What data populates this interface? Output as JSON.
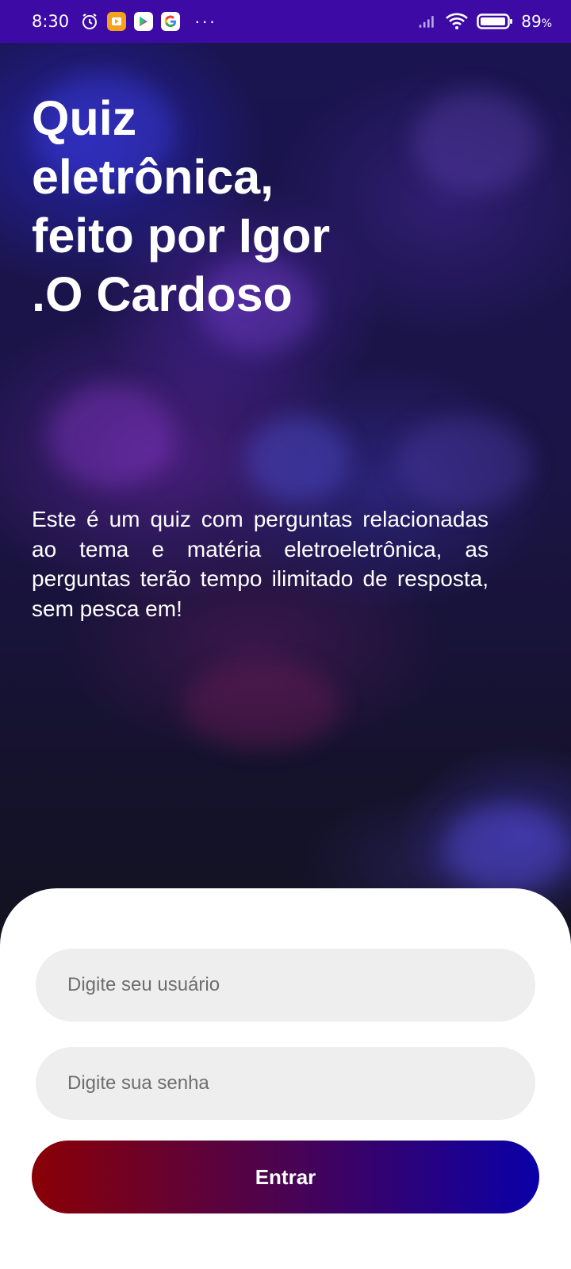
{
  "status_bar": {
    "time": "8:30",
    "battery_percent": "89",
    "battery_unit": "%",
    "overflow": "···",
    "icons": [
      "alarm-icon",
      "video-app-icon",
      "play-store-icon",
      "google-icon",
      "signal-icon",
      "wifi-icon",
      "battery-icon"
    ]
  },
  "hero": {
    "title": "Quiz eletrônica, feito por Igor .O Cardoso",
    "description": "Este é um quiz com perguntas relacionadas ao tema e matéria eletroeletrônica, as perguntas terão tempo ilimitado de resposta, sem pesca em!"
  },
  "login": {
    "user_placeholder": "Digite seu usuário",
    "user_value": "",
    "password_placeholder": "Digite sua senha",
    "password_value": "",
    "submit_label": "Entrar"
  },
  "colors": {
    "status_bar": "#3d0aa5",
    "button_gradient_start": "#8a0006",
    "button_gradient_end": "#0a00a8",
    "input_background": "#eeeeee"
  }
}
